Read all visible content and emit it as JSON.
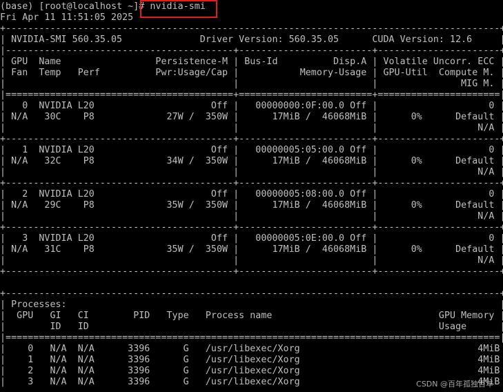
{
  "prompt": {
    "env": "(base)",
    "user_host": "[root@localhost ~]#",
    "command": "nvidia-smi"
  },
  "date_line": "Fri Apr 11 11:51:05 2025",
  "smi_lines": [
    "+-----------------------------------------------------------------------------------------+",
    "| NVIDIA-SMI 560.35.05              Driver Version: 560.35.05      CUDA Version: 12.6     |",
    "|-----------------------------------------+------------------------+----------------------+",
    "| GPU  Name                 Persistence-M | Bus-Id          Disp.A | Volatile Uncorr. ECC |",
    "| Fan  Temp   Perf          Pwr:Usage/Cap |           Memory-Usage | GPU-Util  Compute M. |",
    "|                                         |                        |               MIG M. |",
    "|=========================================+========================+======================|",
    "|   0  NVIDIA L20                     Off |   00000000:0F:00.0 Off |                    0 |",
    "| N/A   30C    P8             27W /  350W |      17MiB /  46068MiB |      0%      Default |",
    "|                                         |                        |                  N/A |",
    "+-----------------------------------------+------------------------+----------------------+",
    "|   1  NVIDIA L20                     Off |   00000005:05:00.0 Off |                    0 |",
    "| N/A   32C    P8             34W /  350W |      17MiB /  46068MiB |      0%      Default |",
    "|                                         |                        |                  N/A |",
    "+-----------------------------------------+------------------------+----------------------+",
    "|   2  NVIDIA L20                     Off |   00000005:08:00.0 Off |                    0 |",
    "| N/A   29C    P8             35W /  350W |      17MiB /  46068MiB |      0%      Default |",
    "|                                         |                        |                  N/A |",
    "+-----------------------------------------+------------------------+----------------------+",
    "|   3  NVIDIA L20                     Off |   00000005:0E:00.0 Off |                    0 |",
    "| N/A   31C    P8             35W /  350W |      17MiB /  46068MiB |      0%      Default |",
    "|                                         |                        |                  N/A |",
    "+-----------------------------------------+------------------------+----------------------+",
    "",
    "+-----------------------------------------------------------------------------------------+",
    "| Processes:                                                                              |",
    "|  GPU   GI   CI        PID   Type   Process name                              GPU Memory |",
    "|        ID   ID                                                               Usage      |",
    "|=========================================================================================|",
    "|    0   N/A  N/A      3396      G   /usr/libexec/Xorg                                4MiB |",
    "|    1   N/A  N/A      3396      G   /usr/libexec/Xorg                                4MiB |",
    "|    2   N/A  N/A      3396      G   /usr/libexec/Xorg                                4MiB |",
    "|    3   N/A  N/A      3396      G   /usr/libexec/Xorg                                4MiB |"
  ],
  "watermark": "CSDN @百年孤独百年"
}
